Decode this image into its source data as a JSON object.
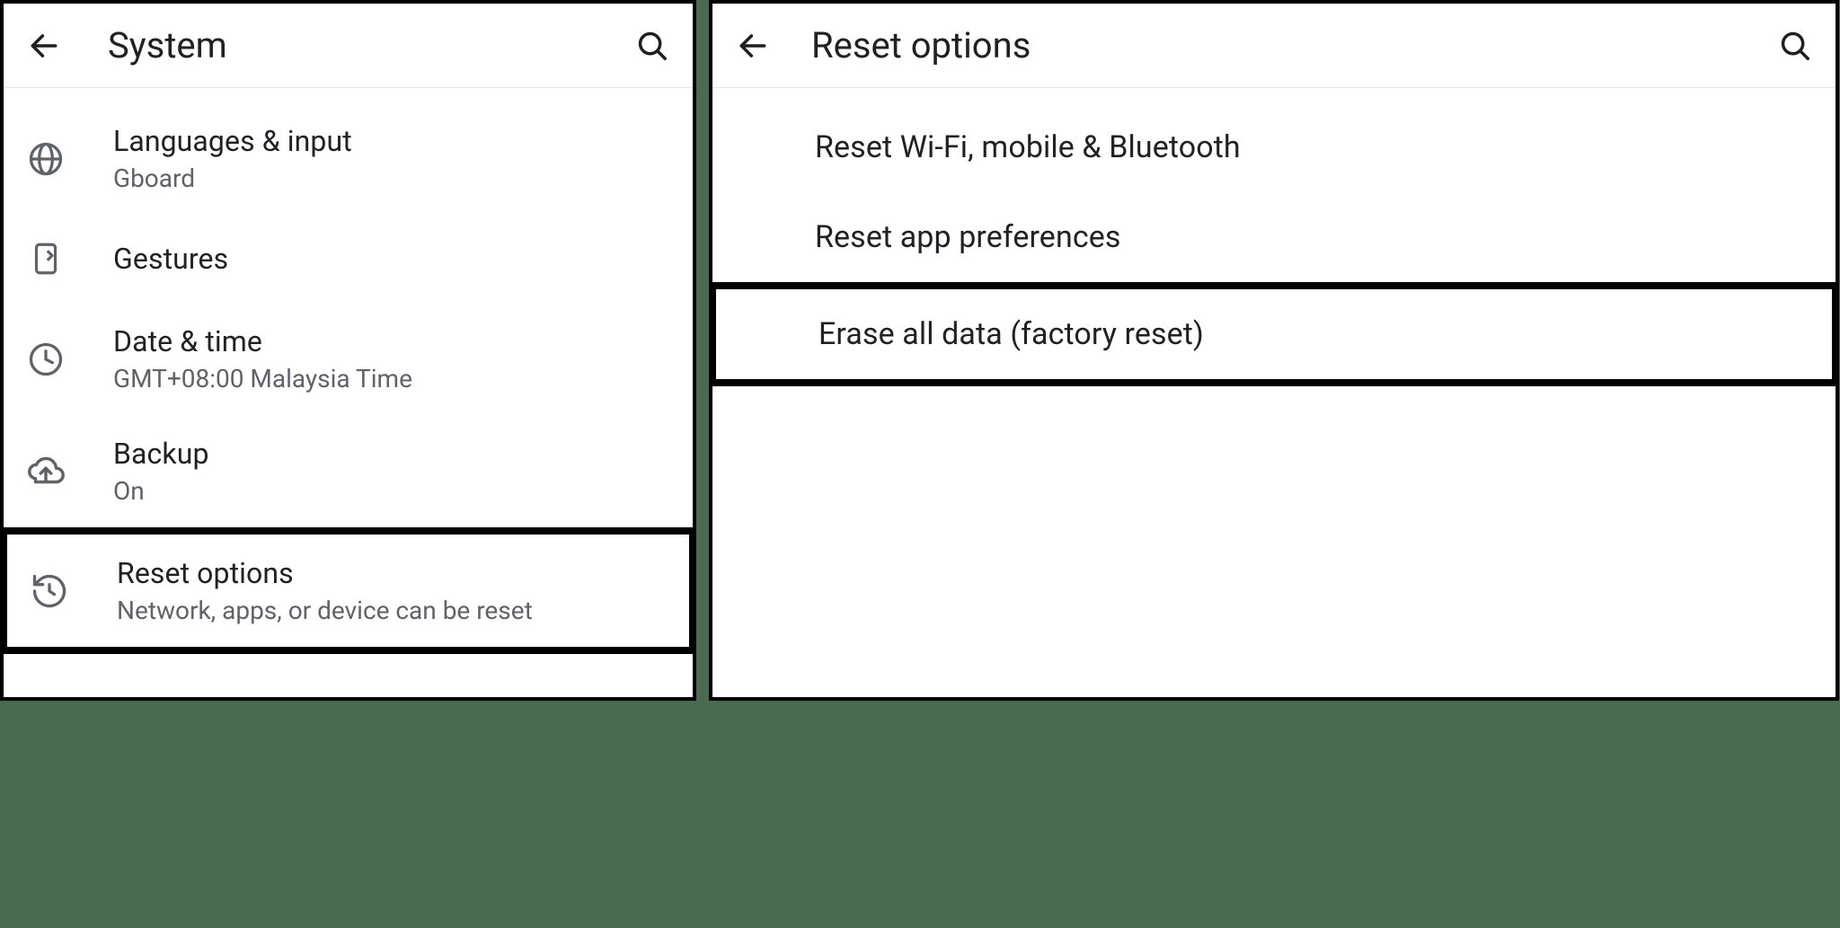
{
  "left": {
    "header": {
      "title": "System"
    },
    "items": [
      {
        "icon": "globe-icon",
        "primary": "Languages & input",
        "secondary": "Gboard"
      },
      {
        "icon": "gesture-icon",
        "primary": "Gestures",
        "secondary": ""
      },
      {
        "icon": "clock-icon",
        "primary": "Date & time",
        "secondary": "GMT+08:00 Malaysia Time"
      },
      {
        "icon": "cloud-upload-icon",
        "primary": "Backup",
        "secondary": "On"
      },
      {
        "icon": "restore-icon",
        "primary": "Reset options",
        "secondary": "Network, apps, or device can be reset",
        "highlighted": true
      }
    ]
  },
  "right": {
    "header": {
      "title": "Reset options"
    },
    "items": [
      {
        "primary": "Reset Wi-Fi, mobile & Bluetooth"
      },
      {
        "primary": "Reset app preferences"
      },
      {
        "primary": "Erase all data (factory reset)",
        "highlighted": true
      }
    ]
  }
}
